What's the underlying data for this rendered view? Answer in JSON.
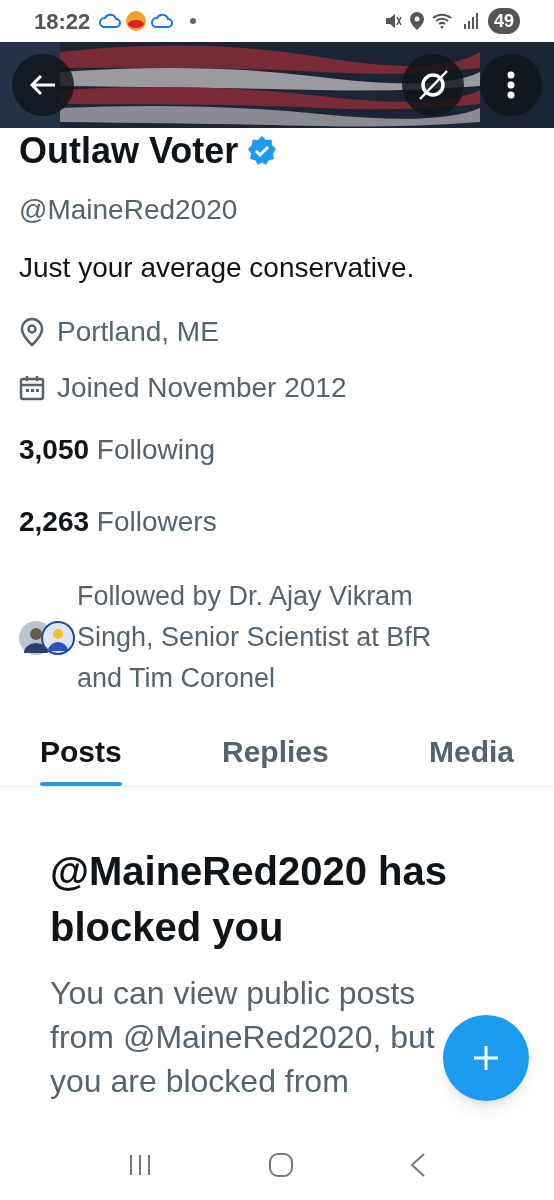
{
  "status_bar": {
    "time": "18:22",
    "battery": "49"
  },
  "profile": {
    "name": "Outlaw Voter",
    "verified": true,
    "handle": "@MaineRed2020",
    "bio": "Just your average conservative.",
    "location": "Portland, ME",
    "joined": "Joined November 2012",
    "stats": [
      {
        "count": "3,050",
        "label": "Following"
      },
      {
        "count": "2,263",
        "label": "Followers"
      }
    ],
    "followed_by": "Followed by Dr. Ajay Vikram Singh, Senior Scientist at BfR and Tim Coronel"
  },
  "tabs": [
    {
      "label": "Posts",
      "selected": true
    },
    {
      "label": "Replies",
      "selected": false
    },
    {
      "label": "Media",
      "selected": false
    }
  ],
  "blocked": {
    "title": "@MaineRed2020 has blocked you",
    "message": "You can view public posts from @MaineRed2020, but you are blocked from"
  }
}
